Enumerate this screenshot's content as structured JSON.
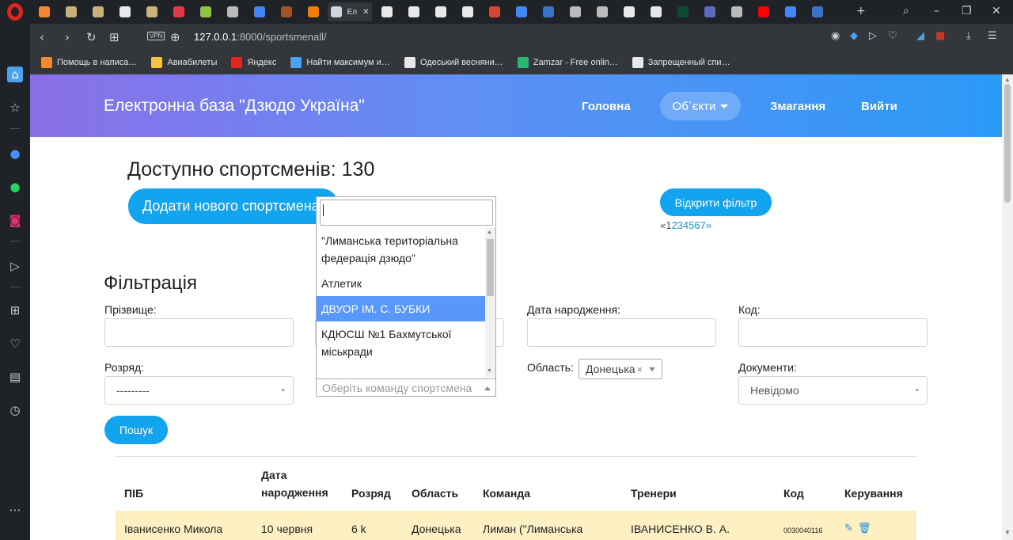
{
  "browser": {
    "active_tab_label": "Ел",
    "url_host": "127.0.0.1",
    "url_path": ":8000/sportsmenall/",
    "vpn_label": "VPN",
    "bookmarks": [
      {
        "label": "Помощь в написа…",
        "color": "#f28a30"
      },
      {
        "label": "Авиабилеты",
        "color": "#f5c542"
      },
      {
        "label": "Яндекс",
        "color": "#e52620"
      },
      {
        "label": "Найти максимум и…",
        "color": "#4aa3f0"
      },
      {
        "label": "Одеський весняни…",
        "color": "#e8e8e8"
      },
      {
        "label": "Zamzar - Free onlin…",
        "color": "#2bb673"
      },
      {
        "label": "Запрещенный спи…",
        "color": "#e8e8e8"
      }
    ]
  },
  "header": {
    "brand": "Електронна база \"Дзюдо Україна\"",
    "nav_home": "Головна",
    "nav_objects": "Об`єкти",
    "nav_competitions": "Змагання",
    "nav_logout": "Вийти"
  },
  "summary": {
    "available_text": "Доступно спортсменів: 130",
    "add_button": "Додати нового спортсмена",
    "open_filter_button": "Відкрити фільтр",
    "pager_prev": "«",
    "pager_current": "1",
    "pager_pages": "234567",
    "pager_next": "»"
  },
  "filter": {
    "title": "Фільтрація",
    "surname_label": "Прізвище:",
    "birth_label": "Дата народження:",
    "code_label": "Код:",
    "rank_label": "Розряд:",
    "rank_value": "---------",
    "region_label": "Область:",
    "region_value": "Донецька",
    "region_clear": "×",
    "documents_label": "Документи:",
    "documents_value": "Невідомо",
    "search_button": "Пошук"
  },
  "team_dropdown": {
    "search_value": "",
    "placeholder": "Оберіть команду спортсмена",
    "options": [
      {
        "label": "\"Лиманська територіальна федерація дзюдо\"",
        "highlighted": false
      },
      {
        "label": "Атлетик",
        "highlighted": false
      },
      {
        "label": "ДВУОР ІМ. С. БУБКИ",
        "highlighted": true
      },
      {
        "label": "КДЮСШ №1 Бахмутської міськради",
        "highlighted": false
      }
    ]
  },
  "table": {
    "headers": {
      "name": "ПІБ",
      "birth_line1": "Дата",
      "birth_line2": "народження",
      "rank": "Розряд",
      "region": "Область",
      "team": "Команда",
      "coaches": "Тренери",
      "code": "Код",
      "actions": "Керування"
    },
    "rows": [
      {
        "name": "Іванисенко Микола",
        "birth": "10 червня",
        "rank": "6 k",
        "region": "Донецька",
        "team": "Лиман (\"Лиманська",
        "coaches": "ІВАНИСЕНКО В. А.",
        "code": "0030040116"
      }
    ]
  }
}
